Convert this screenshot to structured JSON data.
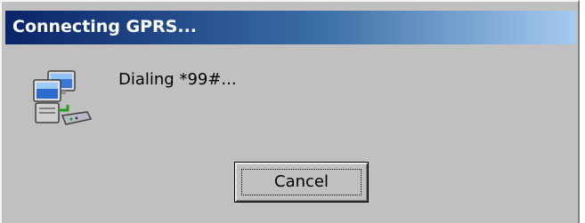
{
  "window": {
    "title": "Connecting GPRS..."
  },
  "dialog": {
    "message": "Dialing *99#...",
    "icon": "network-connection-icon",
    "cancel_label": "Cancel"
  },
  "colors": {
    "face": "#c0c0c0",
    "title_start": "#0a246a",
    "title_end": "#a6caf0",
    "title_text": "#ffffff"
  }
}
